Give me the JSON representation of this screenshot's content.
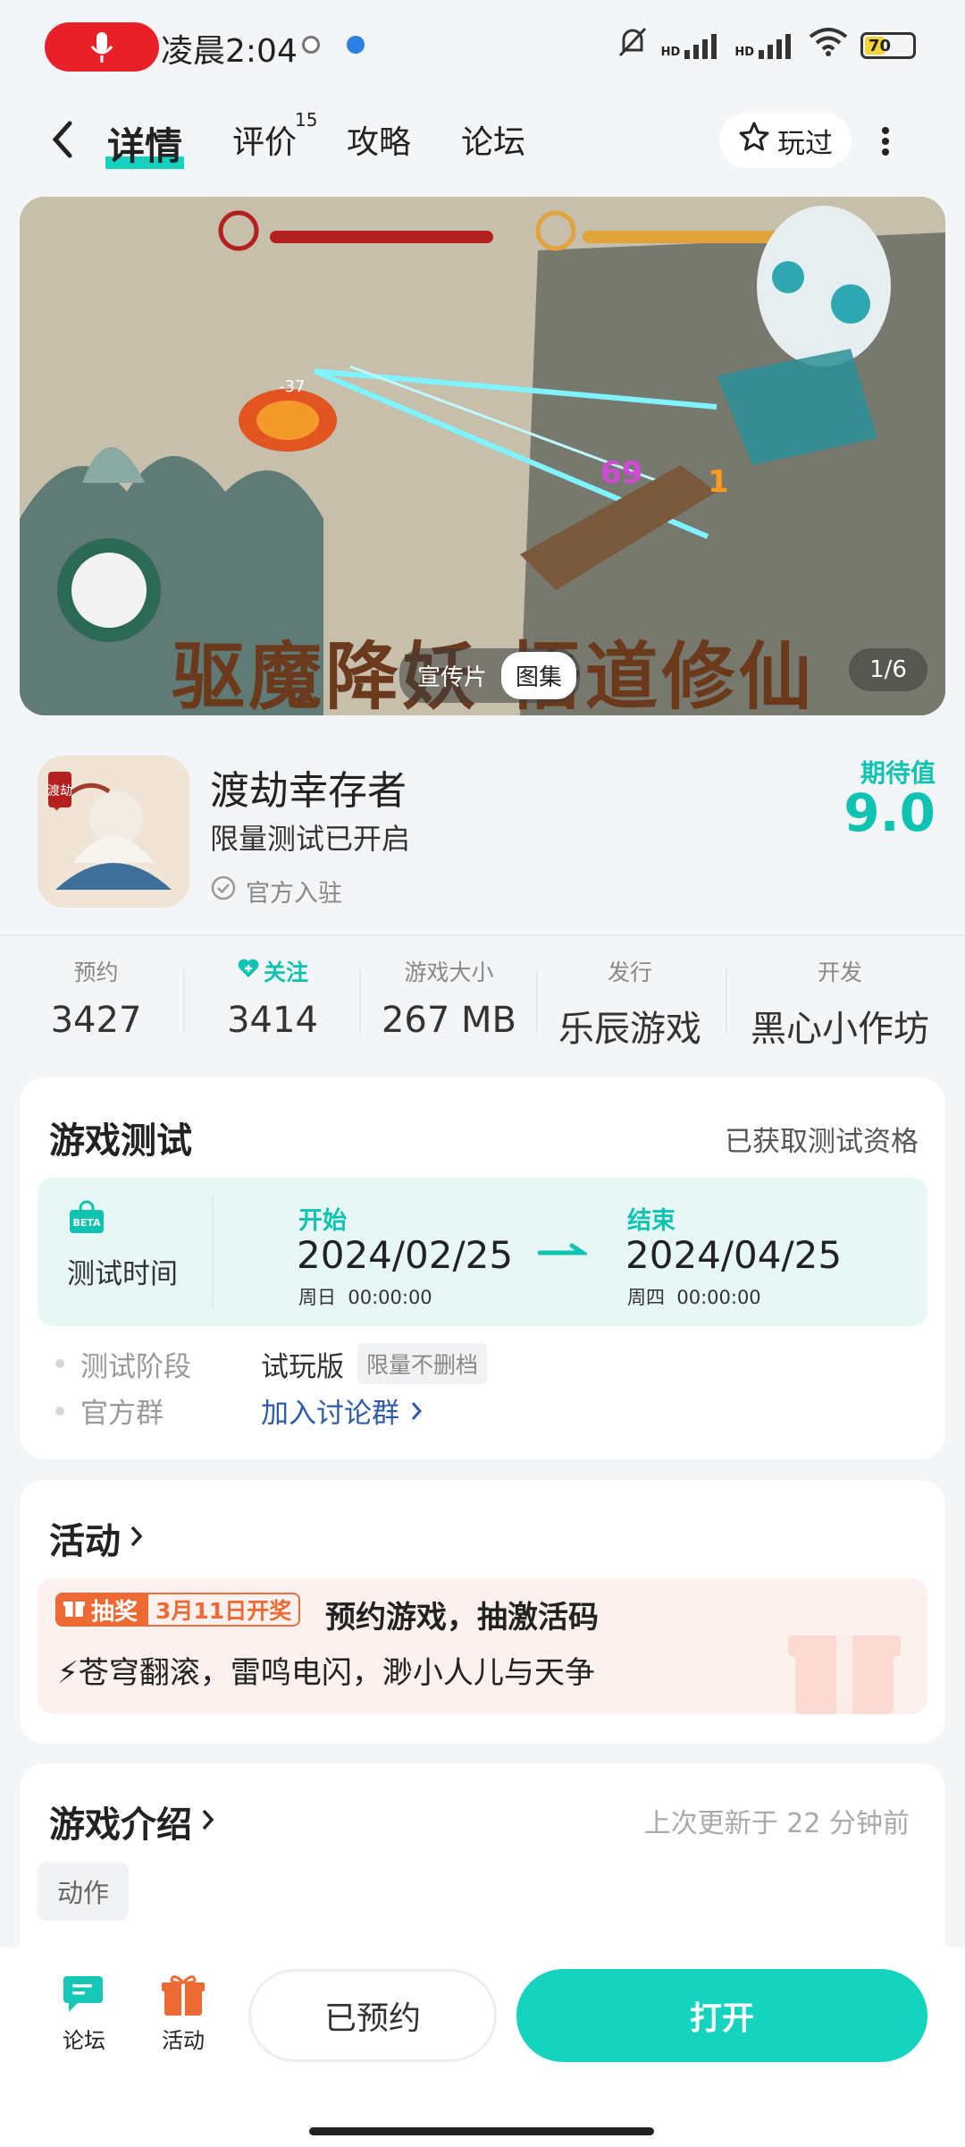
{
  "status_bar": {
    "time": "凌晨2:04",
    "battery": "70",
    "net1": "HD",
    "net2": "HD"
  },
  "nav": {
    "tabs": [
      "详情",
      "评价",
      "攻略",
      "论坛"
    ],
    "review_count": "15",
    "played_label": "玩过"
  },
  "banner": {
    "title_text": "驱魔降妖 悟道修仙",
    "media_tabs": [
      "宣传片",
      "图集"
    ],
    "pager": "1/6"
  },
  "game": {
    "name": "渡劫幸存者",
    "subtitle": "限量测试已开启",
    "official": "官方入驻",
    "icon_text": "渡劫",
    "expect_label": "期待值",
    "expect_value": "9.0"
  },
  "stats": [
    {
      "label": "预约",
      "value": "3427"
    },
    {
      "label": "关注",
      "value": "3414"
    },
    {
      "label": "游戏大小",
      "value": "267 MB"
    },
    {
      "label": "发行",
      "value": "乐辰游戏"
    },
    {
      "label": "开发",
      "value": "黑心小作坊"
    }
  ],
  "test": {
    "title": "游戏测试",
    "status": "已获取测试资格",
    "time_label": "测试时间",
    "beta": "BETA",
    "start_label": "开始",
    "start_date": "2024/02/25",
    "start_sub": "周日  00:00:00",
    "end_label": "结束",
    "end_date": "2024/04/25",
    "end_sub": "周四  00:00:00",
    "stage_label": "测试阶段",
    "stage_value": "试玩版",
    "stage_tag": "限量不删档",
    "group_label": "官方群",
    "group_value": "加入讨论群"
  },
  "activity": {
    "title": "活动",
    "lottery_tag": "抽奖",
    "lottery_date": "3月11日开奖",
    "headline": "预约游戏，抽激活码",
    "body": "⚡苍穹翻滚，雷鸣电闪，渺小人儿与天争"
  },
  "intro": {
    "title": "游戏介绍",
    "updated": "上次更新于 22 分钟前",
    "tag": "动作"
  },
  "bottom": {
    "forum": "论坛",
    "activity": "活动",
    "reserved": "已预约",
    "open": "打开"
  },
  "colors": {
    "accent": "#16d3c0",
    "orange": "#ee6a35",
    "link": "#2e5aa8"
  }
}
